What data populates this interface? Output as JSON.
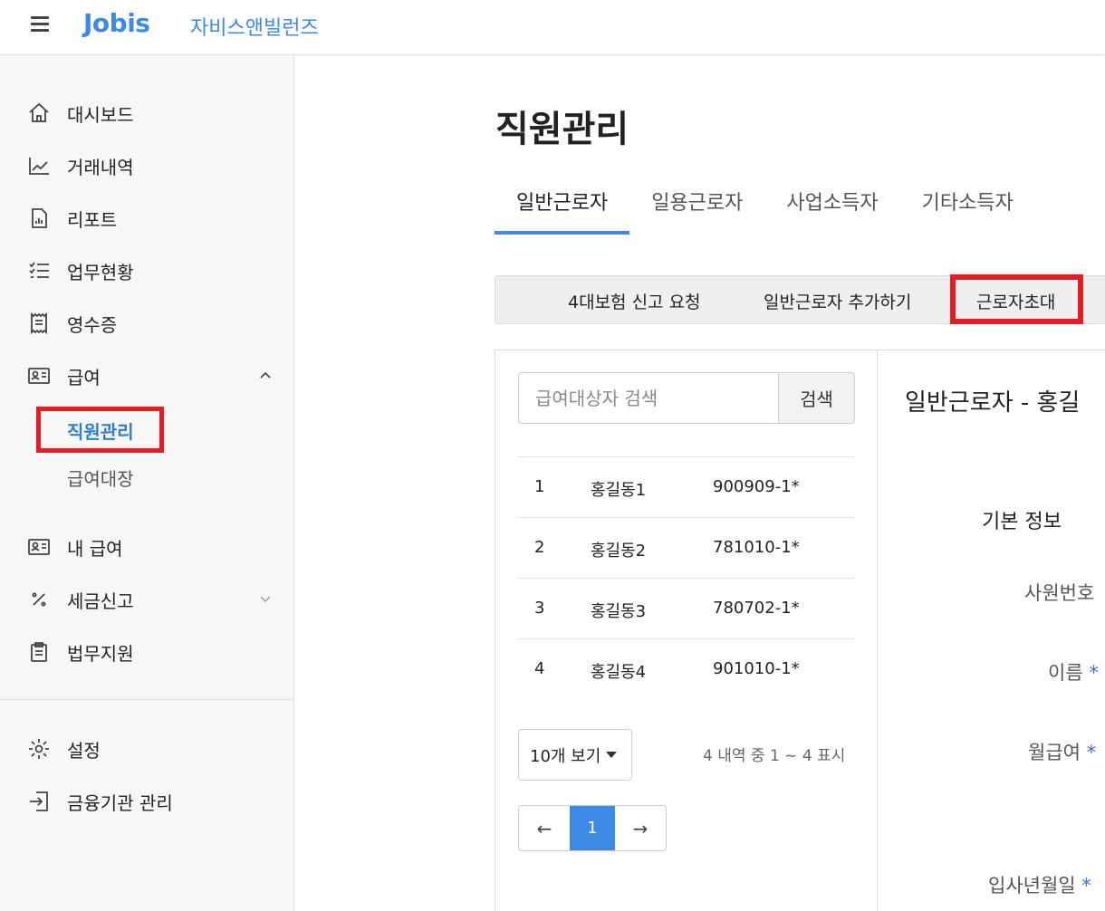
{
  "header": {
    "logo": "Jobis",
    "company": "자비스앤빌런즈"
  },
  "sidebar": {
    "items": [
      {
        "label": "대시보드",
        "icon": "home-icon"
      },
      {
        "label": "거래내역",
        "icon": "chart-line-icon"
      },
      {
        "label": "리포트",
        "icon": "report-icon"
      },
      {
        "label": "업무현황",
        "icon": "checklist-icon"
      },
      {
        "label": "영수증",
        "icon": "receipt-icon"
      },
      {
        "label": "급여",
        "icon": "id-card-icon",
        "expanded": true
      },
      {
        "label": "내 급여",
        "icon": "id-card-icon"
      },
      {
        "label": "세금신고",
        "icon": "percent-icon",
        "expanded": false
      },
      {
        "label": "법무지원",
        "icon": "clipboard-icon"
      },
      {
        "label": "설정",
        "icon": "gear-icon"
      },
      {
        "label": "금융기관 관리",
        "icon": "login-icon"
      }
    ],
    "payroll_sub": [
      "직원관리",
      "급여대장"
    ]
  },
  "main": {
    "title": "직원관리",
    "tabs": [
      "일반근로자",
      "일용근로자",
      "사업소득자",
      "기타소득자"
    ],
    "toolbar": [
      "4대보험 신고 요청",
      "일반근로자 추가하기",
      "근로자초대"
    ],
    "search": {
      "placeholder": "급여대상자 검색",
      "button": "검색"
    },
    "rows": [
      {
        "no": "1",
        "name": "홍길동1",
        "id": "900909-1*"
      },
      {
        "no": "2",
        "name": "홍길동2",
        "id": "781010-1*"
      },
      {
        "no": "3",
        "name": "홍길동3",
        "id": "780702-1*"
      },
      {
        "no": "4",
        "name": "홍길동4",
        "id": "901010-1*"
      }
    ],
    "page_size": "10개 보기",
    "page_info": "4 내역 중 1 ~ 4 표시",
    "pager": {
      "prev": "←",
      "current": "1",
      "next": "→"
    }
  },
  "detail": {
    "title": "일반근로자 - 홍길",
    "section": "기본 정보",
    "fields": [
      "사원번호",
      "이름",
      "월급여",
      "입사년월일"
    ],
    "required_mark": "*"
  },
  "colors": {
    "accent": "#3d8ae6",
    "highlight": "#e51c23"
  }
}
